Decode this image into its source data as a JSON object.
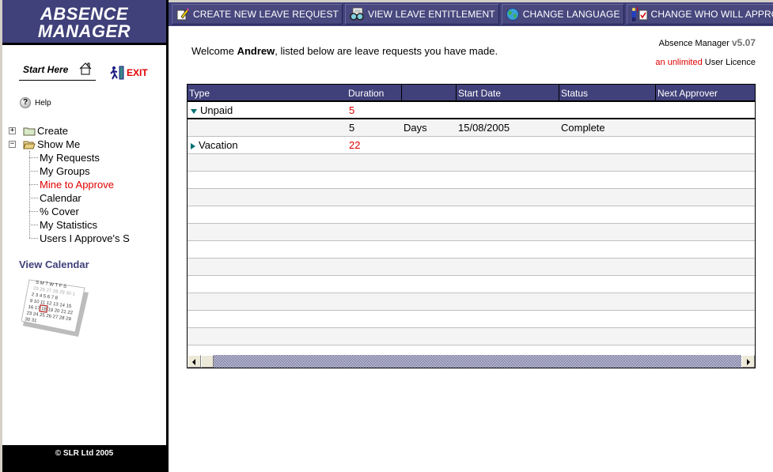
{
  "sidebar": {
    "brand_line1": "ABSENCE",
    "brand_line2": "MANAGER",
    "start_here": "Start Here",
    "exit_label": "EXIT",
    "help_label": "Help",
    "tree": {
      "create": "Create",
      "show_me": "Show Me",
      "children": [
        {
          "label": "My Requests",
          "highlight": false
        },
        {
          "label": "My Groups",
          "highlight": false
        },
        {
          "label": "Mine to Approve",
          "highlight": true
        },
        {
          "label": "Calendar",
          "highlight": false
        },
        {
          "label": "%  Cover",
          "highlight": false
        },
        {
          "label": "My Statistics",
          "highlight": false
        },
        {
          "label": "Users I Approve's S",
          "highlight": false
        }
      ]
    },
    "view_calendar": "View Calendar",
    "footer": "© SLR Ltd 2005"
  },
  "toolbar": {
    "buttons": [
      {
        "label": "CREATE NEW LEAVE REQUEST",
        "icon": "pencil-note-icon"
      },
      {
        "label": "VIEW LEAVE ENTITLEMENT",
        "icon": "glasses-document-icon"
      },
      {
        "label": "CHANGE LANGUAGE",
        "icon": "globe-icon"
      },
      {
        "label": "CHANGE WHO WILL APPROVE MY REQUESTS",
        "icon": "approver-icon"
      }
    ]
  },
  "main": {
    "welcome_prefix": "Welcome ",
    "user_name": "Andrew",
    "welcome_suffix": ", listed below are leave requests you have made.",
    "app_name": "Absence Manager ",
    "version": "v5.07",
    "licence_red": "an unlimited",
    "licence_rest": " User Licence"
  },
  "grid": {
    "columns": [
      "Type",
      "Duration",
      "",
      "Start Date",
      "Status",
      "Next Approver"
    ],
    "rows": [
      {
        "kind": "group",
        "expanded": true,
        "type": "Unpaid",
        "duration": "5"
      },
      {
        "kind": "detail",
        "duration": "5",
        "unit": "Days",
        "start_date": "15/08/2005",
        "status": "Complete",
        "next_approver": ""
      },
      {
        "kind": "group",
        "expanded": false,
        "type": "Vacation",
        "duration": "22"
      }
    ]
  },
  "colors": {
    "brand": "#40407a",
    "accent_red": "#e00000",
    "tree_arrow": "#007070"
  }
}
